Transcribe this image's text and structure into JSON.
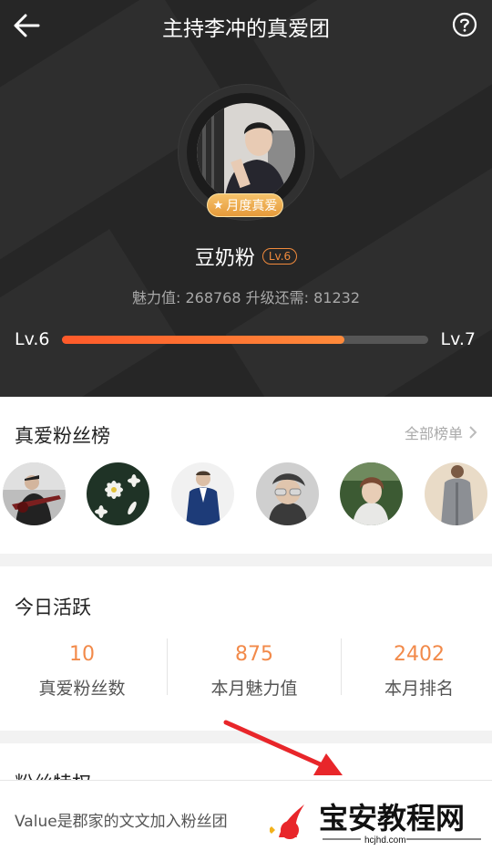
{
  "header": {
    "title": "主持李冲的真爱团"
  },
  "profile": {
    "badge": "月度真爱",
    "name": "豆奶粉",
    "level_tag": "Lv.6",
    "charm_line": "魅力值: 268768 升级还需: 81232",
    "progress": {
      "from": "Lv.6",
      "to": "Lv.7",
      "fraction": 0.77
    }
  },
  "fans": {
    "title": "真爱粉丝榜",
    "more": "全部榜单",
    "avatars": [
      "guitarist-avatar",
      "flowers-avatar",
      "suit-man-avatar",
      "sunglasses-avatar",
      "forest-portrait-avatar",
      "grey-coat-avatar"
    ]
  },
  "today": {
    "title": "今日活跃",
    "stats": [
      {
        "value": "10",
        "label": "真爱粉丝数"
      },
      {
        "value": "875",
        "label": "本月魅力值"
      },
      {
        "value": "2402",
        "label": "本月排名"
      }
    ]
  },
  "rights": {
    "title": "粉丝特权"
  },
  "bottom": {
    "text": "Value是郡家的文文加入粉丝团"
  },
  "watermark": {
    "brand": "宝安教程网",
    "url": "hcjhd.com"
  },
  "colors": {
    "accent": "#f28a4a",
    "progress": "#ff5a2a",
    "hero_bg": "#262626",
    "arrow": "#e8262a"
  }
}
